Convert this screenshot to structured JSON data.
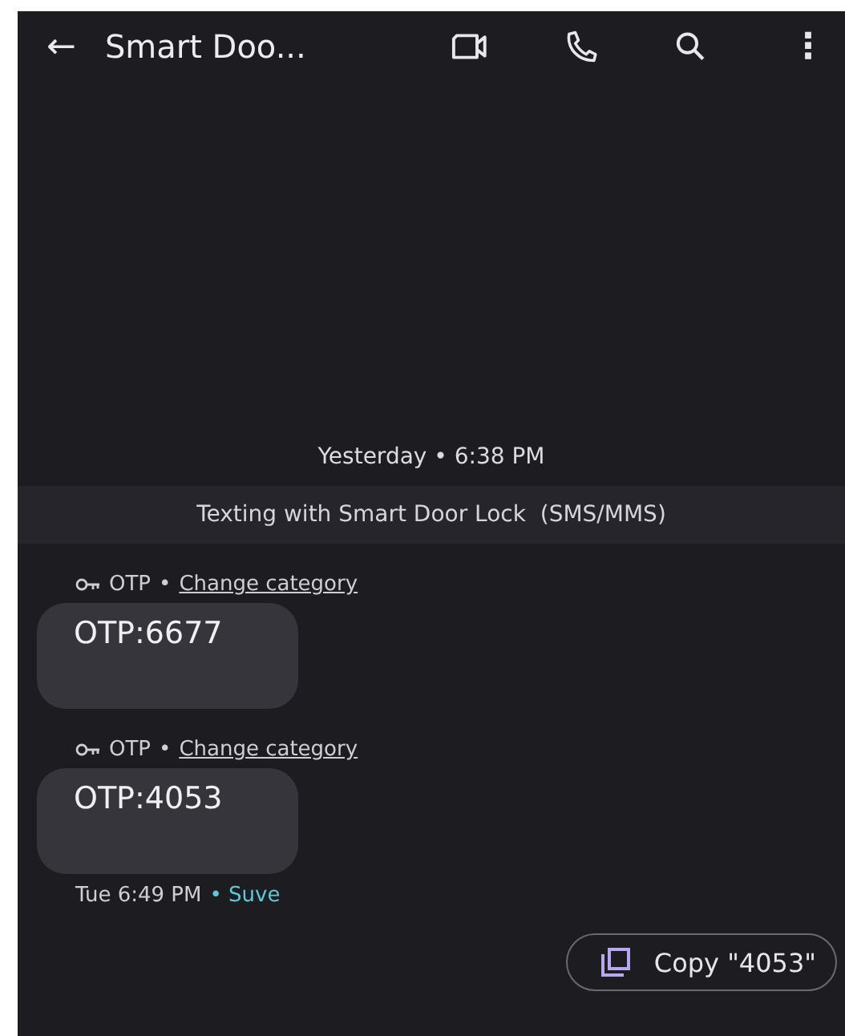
{
  "header": {
    "back": "←",
    "title": "Smart Doo...",
    "more": "⋮"
  },
  "date_divider": "Yesterday • 6:38 PM",
  "banner": "Texting with Smart Door Lock  (SMS/MMS)",
  "messages": [
    {
      "category": "OTP",
      "separator": "•",
      "link": "Change category",
      "text": "OTP:6677"
    },
    {
      "category": "OTP",
      "separator": "•",
      "link": "Change category",
      "text": "OTP:4053",
      "time": "Tue 6:49 PM",
      "status": "• Suve"
    }
  ],
  "copy_chip": "Copy \"4053\""
}
